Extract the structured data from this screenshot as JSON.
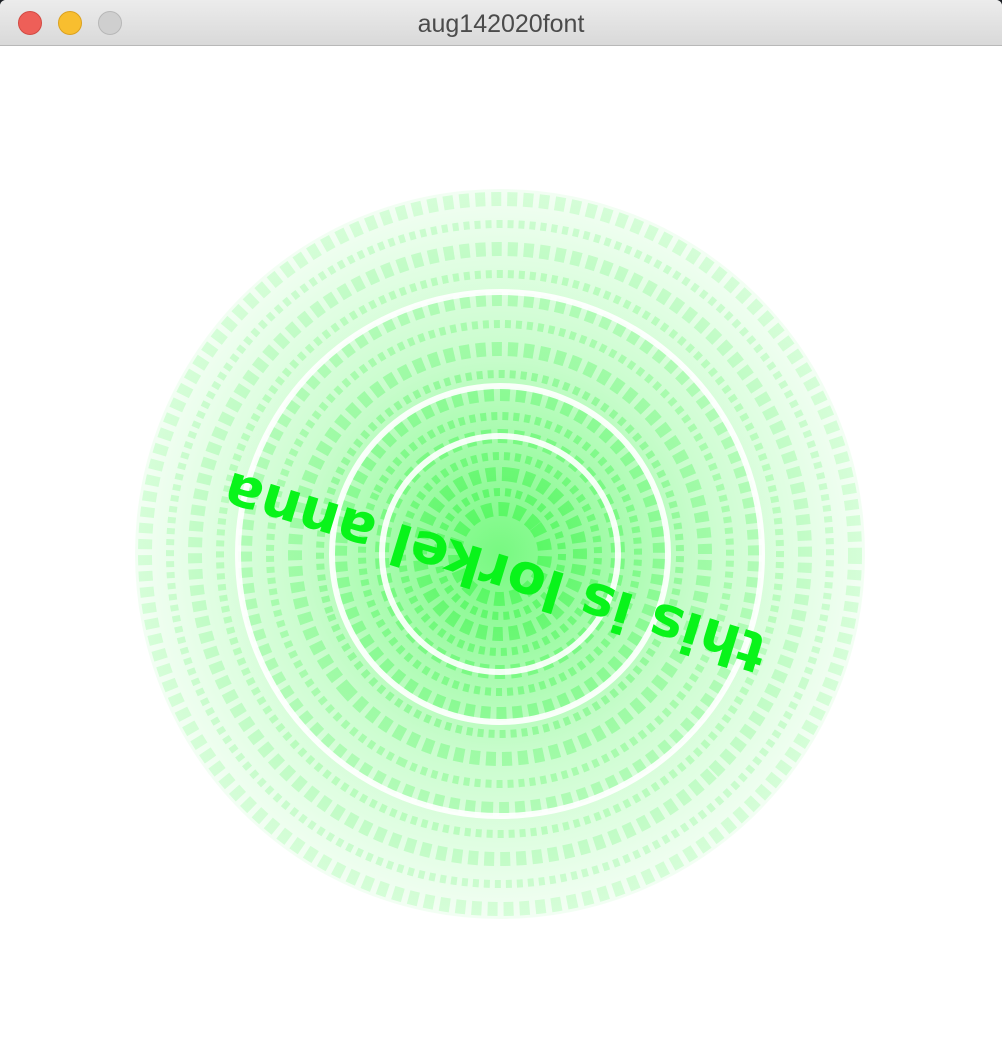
{
  "window": {
    "title": "aug142020font"
  },
  "canvas": {
    "background": "#ffffff",
    "accent": "#09f41a",
    "text": "this is lorkel anna"
  }
}
